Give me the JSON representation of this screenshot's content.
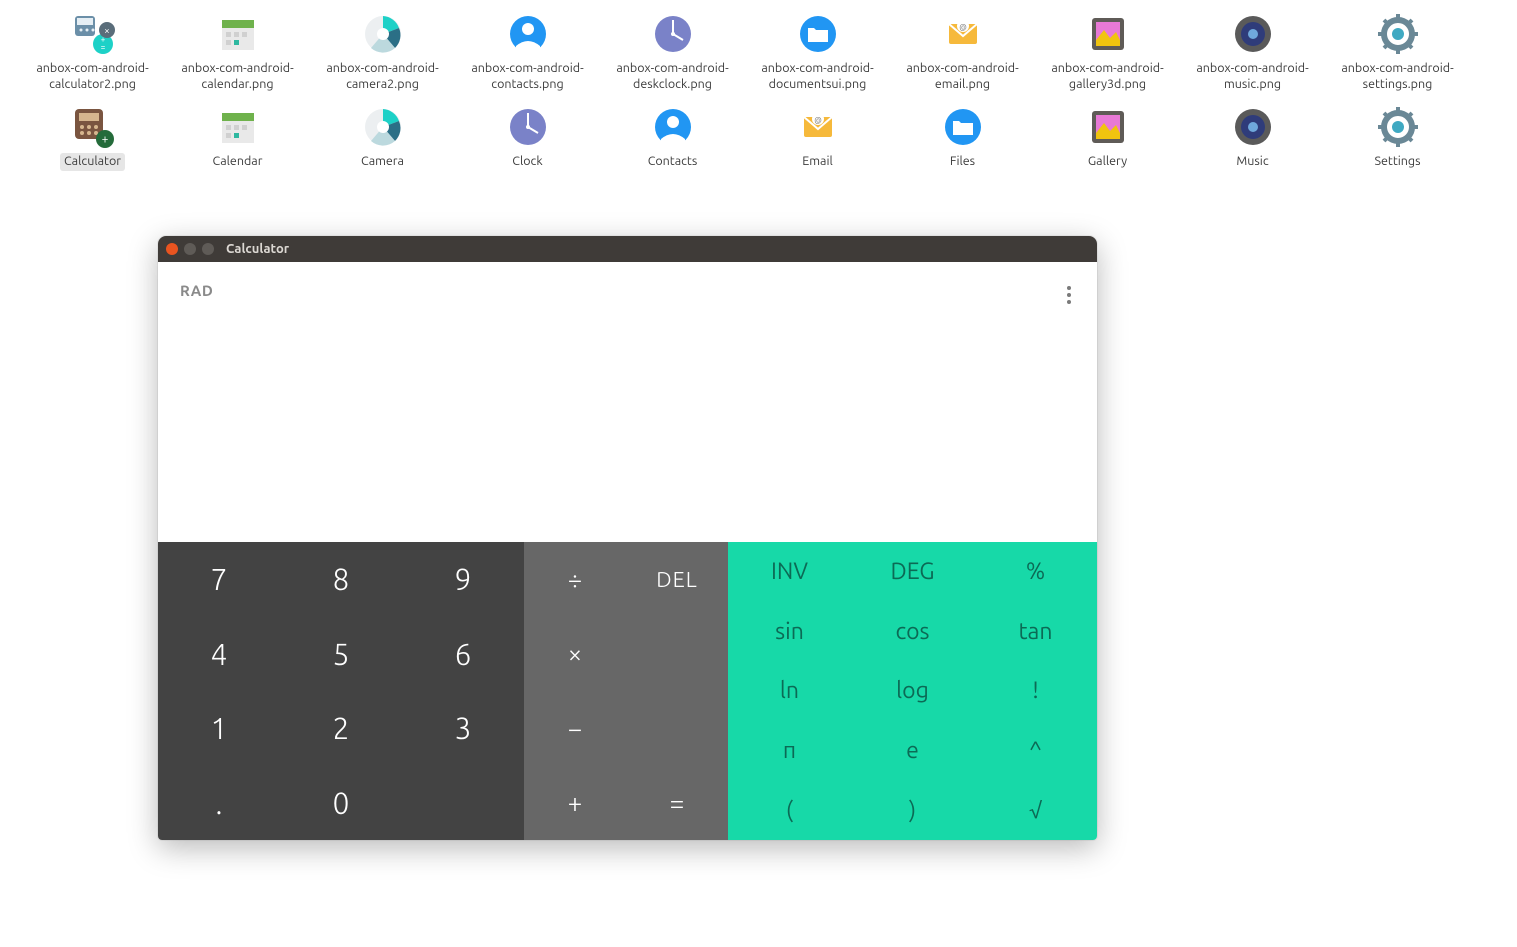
{
  "desktop": {
    "row1": [
      {
        "label": "anbox-com-android-calculator2.png",
        "icon": "calculator-png"
      },
      {
        "label": "anbox-com-android-calendar.png",
        "icon": "calendar-png"
      },
      {
        "label": "anbox-com-android-camera2.png",
        "icon": "camera-png"
      },
      {
        "label": "anbox-com-android-contacts.png",
        "icon": "contacts-png"
      },
      {
        "label": "anbox-com-android-deskclock.png",
        "icon": "clock-png"
      },
      {
        "label": "anbox-com-android-documentsui.png",
        "icon": "files-png"
      },
      {
        "label": "anbox-com-android-email.png",
        "icon": "email-png"
      },
      {
        "label": "anbox-com-android-gallery3d.png",
        "icon": "gallery-png"
      },
      {
        "label": "anbox-com-android-music.png",
        "icon": "music-png"
      },
      {
        "label": "anbox-com-android-settings.png",
        "icon": "settings-png"
      }
    ],
    "row2": [
      {
        "label": "Calculator",
        "icon": "calculator-app",
        "selected": true
      },
      {
        "label": "Calendar",
        "icon": "calendar-app"
      },
      {
        "label": "Camera",
        "icon": "camera-app"
      },
      {
        "label": "Clock",
        "icon": "clock-app"
      },
      {
        "label": "Contacts",
        "icon": "contacts-app"
      },
      {
        "label": "Email",
        "icon": "email-app"
      },
      {
        "label": "Files",
        "icon": "files-app"
      },
      {
        "label": "Gallery",
        "icon": "gallery-app"
      },
      {
        "label": "Music",
        "icon": "music-app"
      },
      {
        "label": "Settings",
        "icon": "settings-app"
      }
    ]
  },
  "window": {
    "title": "Calculator",
    "mode": "RAD",
    "numpad": [
      "7",
      "8",
      "9",
      "4",
      "5",
      "6",
      "1",
      "2",
      "3",
      ".",
      "0",
      ""
    ],
    "ops": [
      "÷",
      "DEL",
      "×",
      "",
      "−",
      "",
      "+",
      "="
    ],
    "adv": [
      "INV",
      "DEG",
      "%",
      "sin",
      "cos",
      "tan",
      "ln",
      "log",
      "!",
      "π",
      "e",
      "^",
      "(",
      ")",
      "√"
    ]
  },
  "colors": {
    "numpad": "#434343",
    "ops": "#676767",
    "adv_bg": "#17d9a8",
    "adv_fg": "#0c6a55",
    "titlebar": "#3f3b38",
    "close_btn": "#e95420"
  }
}
